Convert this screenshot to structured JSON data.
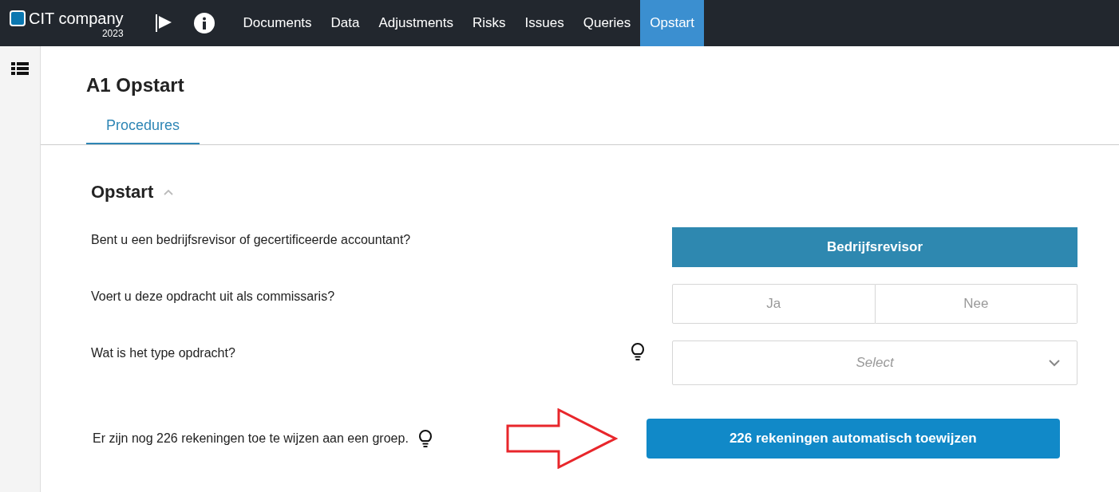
{
  "brand": {
    "name": "CIT company",
    "year": "2023"
  },
  "nav": [
    {
      "label": "Documents",
      "selected": false
    },
    {
      "label": "Data",
      "selected": false
    },
    {
      "label": "Adjustments",
      "selected": false
    },
    {
      "label": "Risks",
      "selected": false
    },
    {
      "label": "Issues",
      "selected": false
    },
    {
      "label": "Queries",
      "selected": false
    },
    {
      "label": "Opstart",
      "selected": true
    }
  ],
  "page_title": "A1 Opstart",
  "tabs": [
    {
      "label": "Procedures",
      "selected": true
    }
  ],
  "section": {
    "title": "Opstart",
    "expanded": true
  },
  "questions": [
    {
      "kind": "options",
      "text": "Bent u een bedrijfsrevisor of gecertificeerde accountant?",
      "hint": false,
      "options": [
        {
          "label": "Bedrijfsrevisor",
          "selected": true
        }
      ]
    },
    {
      "kind": "options",
      "text": "Voert u deze opdracht uit als commissaris?",
      "hint": false,
      "options": [
        {
          "label": "Ja",
          "selected": false
        },
        {
          "label": "Nee",
          "selected": false
        }
      ]
    },
    {
      "kind": "select",
      "text": "Wat is het type opdracht?",
      "hint": true,
      "placeholder": "Select"
    }
  ],
  "action": {
    "text": "Er zijn nog 226 rekeningen toe te wijzen aan een groep.",
    "hint": true,
    "button": "226 rekeningen automatisch toewijzen"
  }
}
